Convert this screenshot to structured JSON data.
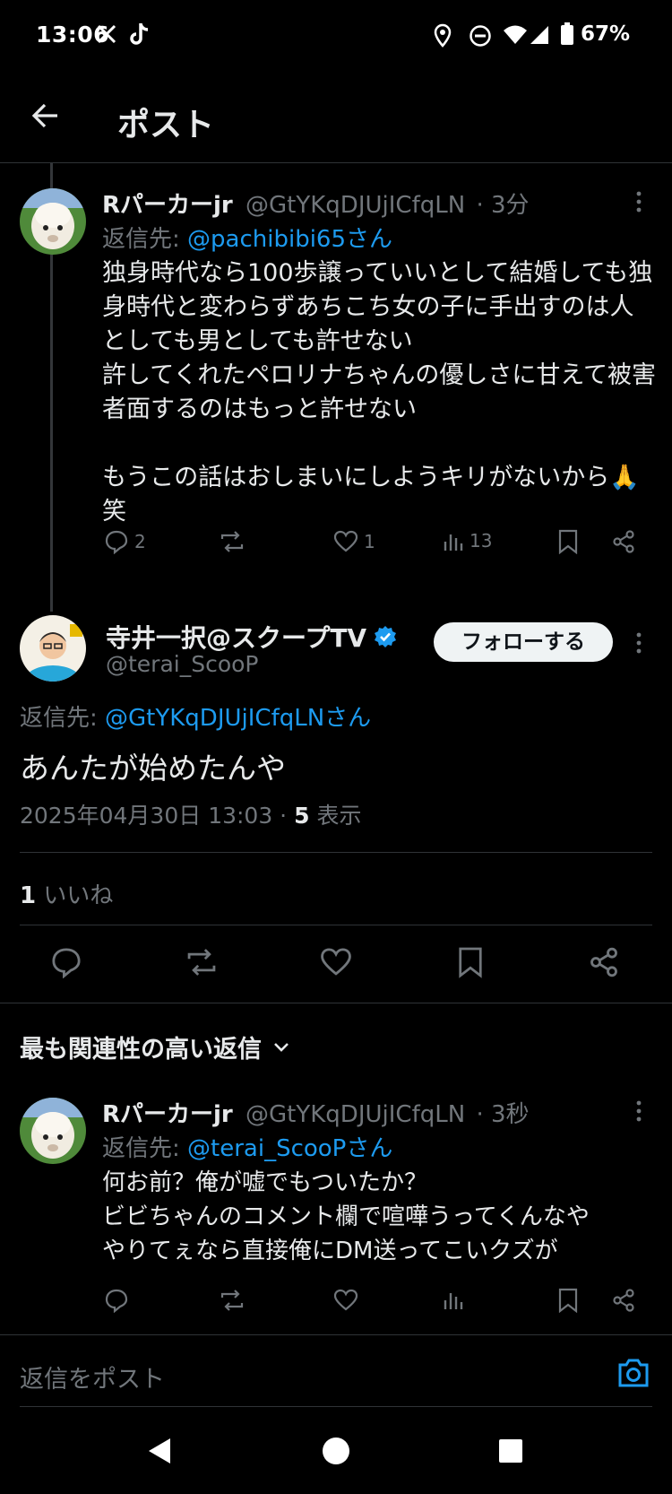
{
  "status_bar": {
    "time": "13:06",
    "battery": "67%"
  },
  "header": {
    "title": "ポスト"
  },
  "reply1": {
    "name": "Rパーカーjr",
    "handle": "@GtYKqDJUjICfqLN",
    "time": "· 3分",
    "reply_to_label": "返信先:",
    "reply_to": "@pachibibi65さん",
    "text": "独身時代なら100歩譲っていいとして結婚しても独身時代と変わらずあちこち女の子に手出すのは人としても男としても許せない\n許してくれたペロリナちゃんの優しさに甘えて被害者面するのはもっと許せない\n\nもうこの話はおしまいにしようキリがないから🙏笑",
    "replies": "2",
    "likes": "1",
    "views": "13"
  },
  "main_post": {
    "name": "寺井一択@スクープTV",
    "handle": "@terai_ScooP",
    "follow_label": "フォローする",
    "reply_to_label": "返信先:",
    "reply_to": "@GtYKqDJUjICfqLNさん",
    "text": "あんたが始めたんや",
    "datetime": "2025年04月30日 13:03 ·",
    "views_count": "5",
    "views_label": "表示",
    "likes_count": "1",
    "likes_label": "いいね"
  },
  "sort": {
    "label": "最も関連性の高い返信"
  },
  "reply2": {
    "name": "Rパーカーjr",
    "handle": "@GtYKqDJUjICfqLN",
    "time": "· 3秒",
    "reply_to_label": "返信先:",
    "reply_to": "@terai_ScooPさん",
    "text": "何お前？俺が嘘でもついたか？\nビビちゃんのコメント欄で喧嘩うってくんなや\nやりてぇなら直接俺にDM送ってこいクズが"
  },
  "reply_bar": {
    "placeholder": "返信をポスト"
  },
  "colors": {
    "accent": "#1d9bf0",
    "muted": "#71767b",
    "background": "#000000"
  }
}
